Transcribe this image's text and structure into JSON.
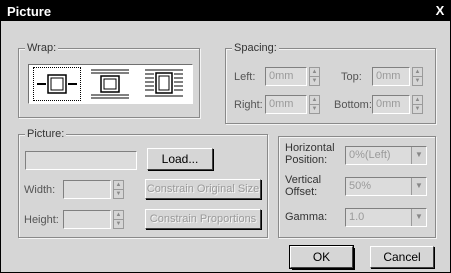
{
  "window": {
    "title": "Picture",
    "close_glyph": "X"
  },
  "wrap": {
    "label": "Wrap:",
    "options": [
      "wrap-none-icon",
      "wrap-top-bottom-icon",
      "wrap-around-icon"
    ],
    "selected_index": 0
  },
  "spacing": {
    "label": "Spacing:",
    "left_label": "Left:",
    "left_value": "0mm",
    "top_label": "Top:",
    "top_value": "0mm",
    "right_label": "Right:",
    "right_value": "0mm",
    "bottom_label": "Bottom:",
    "bottom_value": "0mm"
  },
  "picture": {
    "label": "Picture:",
    "file_value": "",
    "load_label": "Load...",
    "width_label": "Width:",
    "width_value": "",
    "height_label": "Height:",
    "height_value": "",
    "constrain_original_label": "Constrain Original Size",
    "constrain_proportions_label": "Constrain Proportions"
  },
  "position": {
    "h_label_1": "Horizontal",
    "h_label_2": "Position:",
    "h_value": "0%(Left)",
    "v_label_1": "Vertical",
    "v_label_2": "Offset:",
    "v_value": "50%",
    "gamma_label": "Gamma:",
    "gamma_value": "1.0"
  },
  "buttons": {
    "ok_label": "OK",
    "cancel_label": "Cancel"
  },
  "colors": {
    "titlebar": "#000000",
    "dialog_bg": "#d6d6d6",
    "disabled_text": "#9a9a9a"
  }
}
